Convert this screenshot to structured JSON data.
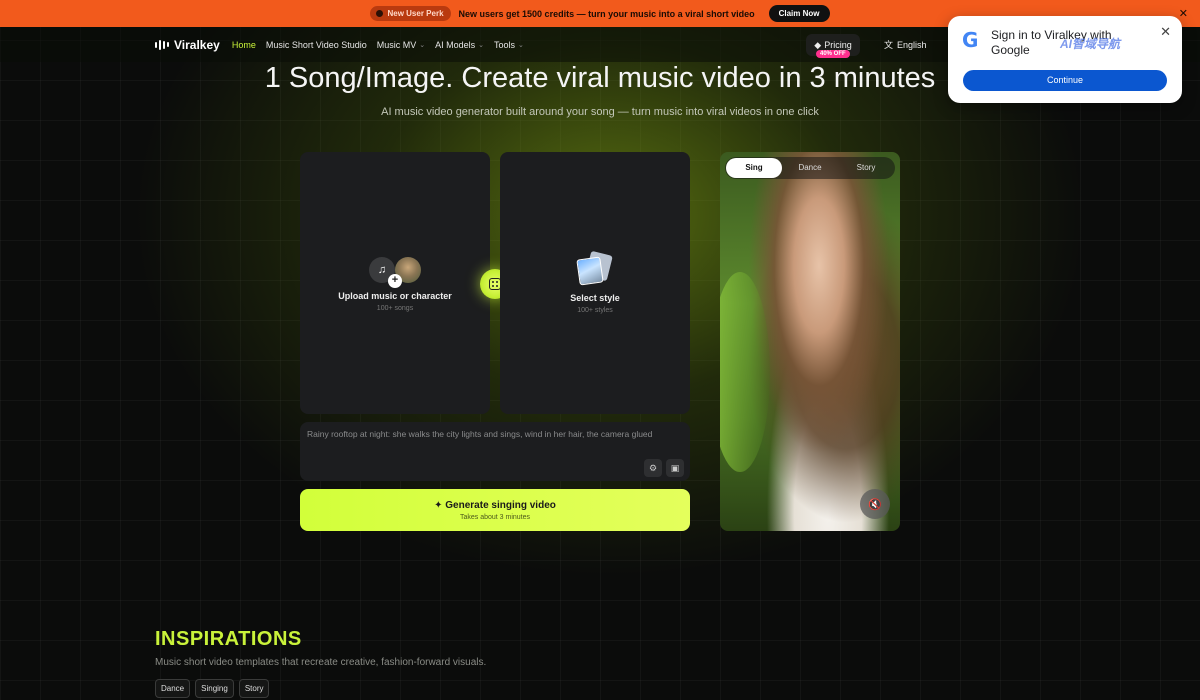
{
  "promo": {
    "perk_label": "New User Perk",
    "message": "New users get 1500 credits — turn your music into a viral short video",
    "claim_label": "Claim Now",
    "close_symbol": "✕"
  },
  "nav": {
    "brand": "Viralkey",
    "items": [
      {
        "label": "Home",
        "active": true
      },
      {
        "label": "Music Short Video Studio"
      },
      {
        "label": "Music MV",
        "has_dropdown": true
      },
      {
        "label": "AI Models",
        "has_dropdown": true
      },
      {
        "label": "Tools",
        "has_dropdown": true
      }
    ],
    "pricing_label": "Pricing",
    "pricing_badge": "40% OFF",
    "language_label": "English"
  },
  "hero": {
    "title": "1 Song/Image. Create viral music video in 3 minutes",
    "subtitle": "AI music video generator built around your song — turn music into viral videos in one click"
  },
  "upload_card": {
    "title": "Upload music or character",
    "subtitle": "100+ songs"
  },
  "style_card": {
    "title": "Select style",
    "subtitle": "100+ styles"
  },
  "prompt": {
    "text": "Rainy rooftop at night: she walks the city lights and sings, wind in her hair, the camera glued"
  },
  "generate": {
    "label": "✦ Generate singing video",
    "sublabel": "Takes about 3 minutes"
  },
  "preview": {
    "tabs": [
      {
        "label": "Sing",
        "active": true
      },
      {
        "label": "Dance"
      },
      {
        "label": "Story"
      }
    ]
  },
  "inspirations": {
    "title": "INSPIRATIONS",
    "subtitle": "Music short video templates that recreate creative, fashion-forward visuals.",
    "chips": [
      "Dance",
      "Singing",
      "Story"
    ]
  },
  "google_popup": {
    "text": "Sign in to Viralkey with Google",
    "button_label": "Continue",
    "watermark": "AI智域导航"
  },
  "colors": {
    "accent": "#c9f23a",
    "promo_bg": "#f25a1c",
    "google_button": "#0b57d0"
  }
}
